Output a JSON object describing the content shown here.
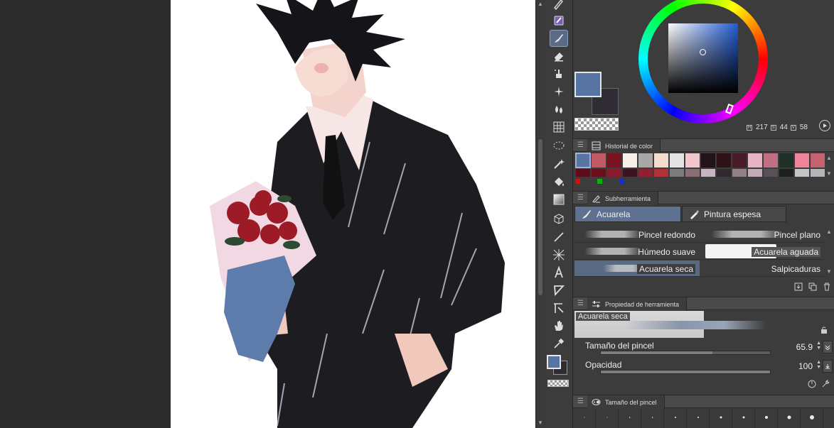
{
  "panels": {
    "color_history": {
      "title": "Historial de color"
    },
    "sub_tool": {
      "title": "Subherramienta"
    },
    "tool_property": {
      "title": "Propiedad de herramienta"
    },
    "brush_size": {
      "title": "Tamaño del pincel"
    }
  },
  "colors": {
    "main": "#5874a2",
    "sub": "#2f2c34"
  },
  "color_wheel": {
    "h": "217",
    "s": "44",
    "v": "58"
  },
  "color_history": {
    "row1": [
      "#5874a2",
      "#c25a64",
      "#7a1320",
      "#f8efe8",
      "#a8a8a8",
      "#f4dccc",
      "#e4e4e4",
      "#f2c8cc",
      "#24121a",
      "#2e1218",
      "#4a1a26",
      "#e8b4c6",
      "#c26e84",
      "#203028",
      "#f0849a",
      "#c46270"
    ],
    "row2": [
      "#5e0c18",
      "#6a0e1c",
      "#8a1a2c",
      "#3c1420",
      "#8e2032",
      "#b23038",
      "#7c7c7c",
      "#8a6e76",
      "#c8b4c0",
      "#302a30",
      "#928088",
      "#c2aab6",
      "#5a5057",
      "#1e1e1e",
      "#c4c4c4",
      "#b8b2ba"
    ]
  },
  "sub_tool": {
    "groups": [
      "Acuarela",
      "Pintura espesa"
    ],
    "brushes_left": [
      "Pincel redondo",
      "Húmedo suave",
      "Acuarela seca"
    ],
    "brushes_right": [
      "Pincel plano",
      "Acuarela aguada",
      "Salpicaduras"
    ]
  },
  "tool_property": {
    "preview_name": "Acuarela seca",
    "brush_size_label": "Tamaño del pincel",
    "brush_size_value": "65.9",
    "brush_size_fraction": 0.66,
    "opacity_label": "Opacidad",
    "opacity_value": "100",
    "opacity_fraction": 1.0
  },
  "icons": {
    "toolbar": [
      "pen-icon",
      "marker-icon",
      "brush-icon",
      "eraser-icon",
      "blend-icon",
      "sparkle-icon",
      "drops-icon",
      "grid-icon",
      "lasso-icon",
      "magic-wand-icon",
      "fill-icon",
      "gradient-icon",
      "cube-icon",
      "line-icon",
      "frame-icon",
      "text-icon",
      "balloon-icon",
      "ruler-icon",
      "hand-icon",
      "eyedropper-icon"
    ]
  }
}
